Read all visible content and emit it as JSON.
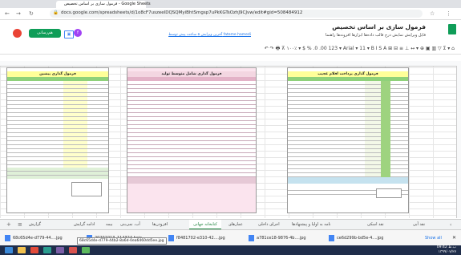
{
  "browser": {
    "tab_title": "فرمول سازی بر اساس تخصیص - Google Sheets",
    "url": "docs.google.com/spreadsheets/d/1o8cF7uszeeIDQSQMyiBhtSmgsp7uPkKGTsOzhJ9CJvw/edit#gid=508484912"
  },
  "sheet": {
    "title": "فرمول سازی بر اساس تخصیص",
    "menus": "فایل   ویرایش   نمایش   درج   قالب   داده‌ها   ابزارها   افزونه‌ها   راهنما",
    "last_edit": "آخرین ویرایش ۵ ساعت پیش توسط fateme hamedi",
    "share_label": "هم‌رسانی",
    "avatar_letter": "f"
  },
  "toolbar": {
    "items": "↶  ↷  🖶  ⊼   ۱۰۰٪ ▾   $   %   .0  .00  123 ▾   Arial ▾   11 ▾   B  I  S  A   ⊞  ⊟   ≡  ⊥  ↔  ▾   ⊕  ▣  ▥  ▽  Σ ▾   ⌂"
  },
  "panels": [
    {
      "title": "فرمول گذاری پرداخت اقلام عجیب",
      "accent": "#1a7f1a"
    },
    {
      "title": "فرمول گذاری شامل متوسط تولید",
      "accent": "#c78ea8"
    },
    {
      "title": "فرمول گذاری پیشین",
      "accent": "#1a7f1a"
    }
  ],
  "sheet_tabs": [
    {
      "label": "نقد آبی",
      "active": false
    },
    {
      "label": "نقد اسکی",
      "active": false
    },
    {
      "label": "نامه به اولیا و پیشنهادها",
      "active": false
    },
    {
      "label": "اجرای داخلی",
      "active": false
    },
    {
      "label": "عمارهای",
      "active": false
    },
    {
      "label": "کتابخانه جهانی",
      "active": true
    },
    {
      "label": "افزودن‌ها",
      "active": false
    },
    {
      "label": "آب، نمی‌بنی",
      "active": false
    },
    {
      "label": "بیمه",
      "active": false
    },
    {
      "label": "ادامه گرایش",
      "active": false
    },
    {
      "label": "گزارش",
      "active": false
    }
  ],
  "downloads": [
    {
      "name": "68c65d4e-d779-44....jpg"
    },
    {
      "name": "20201013_114324.heic"
    },
    {
      "name": "f8481702-e310-42....jpg"
    },
    {
      "name": "a781ce18-9876-4b....jpg"
    },
    {
      "name": "ce6d299b-bd5e-4....jpg"
    }
  ],
  "tooltip": "68c65d4e-d779-44b2-8a6d-0ea6460dd5ee.jpg",
  "show_all": "Show all",
  "clock": {
    "time": "09:42 ب.ظ",
    "date": "۱۳۹۹/۰۷/۲۷"
  },
  "colors": {
    "sheets_green": "#0f9d58",
    "share_red": "#ea4335",
    "link_blue": "#1a73e8",
    "taskbar": "#1f2d4a"
  }
}
